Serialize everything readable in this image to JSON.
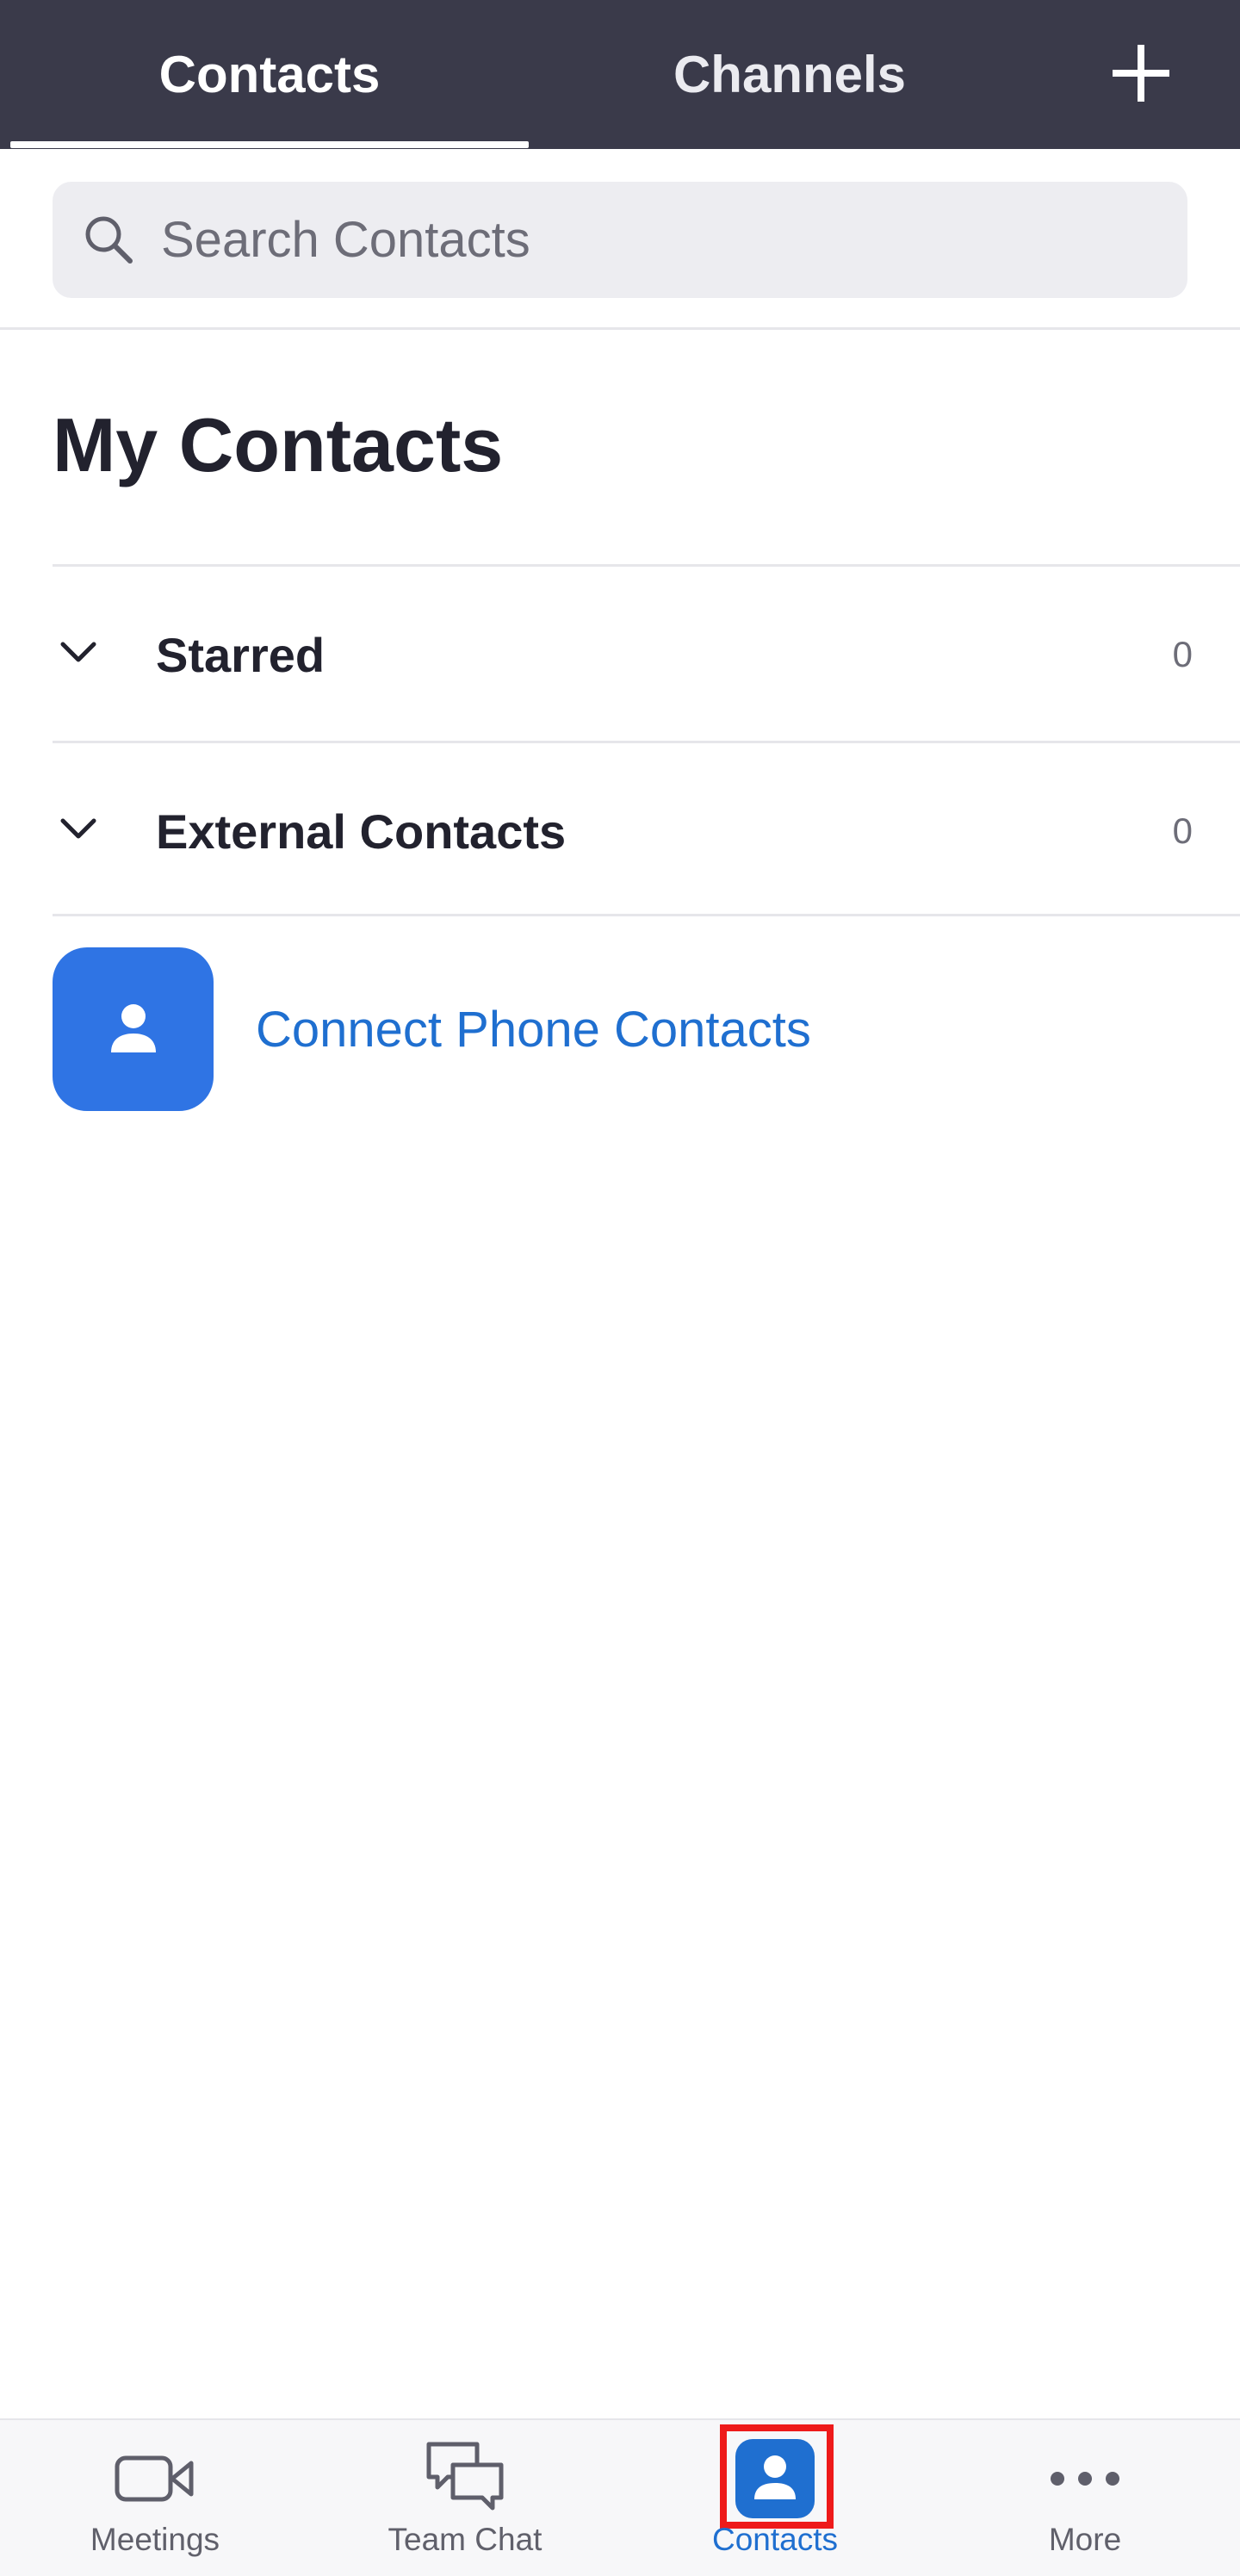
{
  "header": {
    "tabs": [
      {
        "label": "Contacts",
        "active": true
      },
      {
        "label": "Channels",
        "active": false
      }
    ],
    "add_icon": "plus-icon",
    "background": "#3a3a4a"
  },
  "search": {
    "placeholder": "Search Contacts",
    "value": "",
    "icon": "search-icon"
  },
  "main": {
    "title": "My Contacts",
    "groups": [
      {
        "label": "Starred",
        "count": "0",
        "expanded": false
      },
      {
        "label": "External Contacts",
        "count": "0",
        "expanded": false
      }
    ],
    "connect": {
      "label": "Connect Phone Contacts",
      "icon": "person-icon",
      "color": "#2f74e4"
    }
  },
  "bottom_nav": {
    "items": [
      {
        "label": "Meetings",
        "icon": "video-camera-icon",
        "active": false
      },
      {
        "label": "Team Chat",
        "icon": "chat-bubbles-icon",
        "active": false
      },
      {
        "label": "Contacts",
        "icon": "contact-card-icon",
        "active": true
      },
      {
        "label": "More",
        "icon": "more-dots-icon",
        "active": false
      }
    ],
    "active_color": "#1f6fd0",
    "highlight_color": "#ee1a1a"
  }
}
